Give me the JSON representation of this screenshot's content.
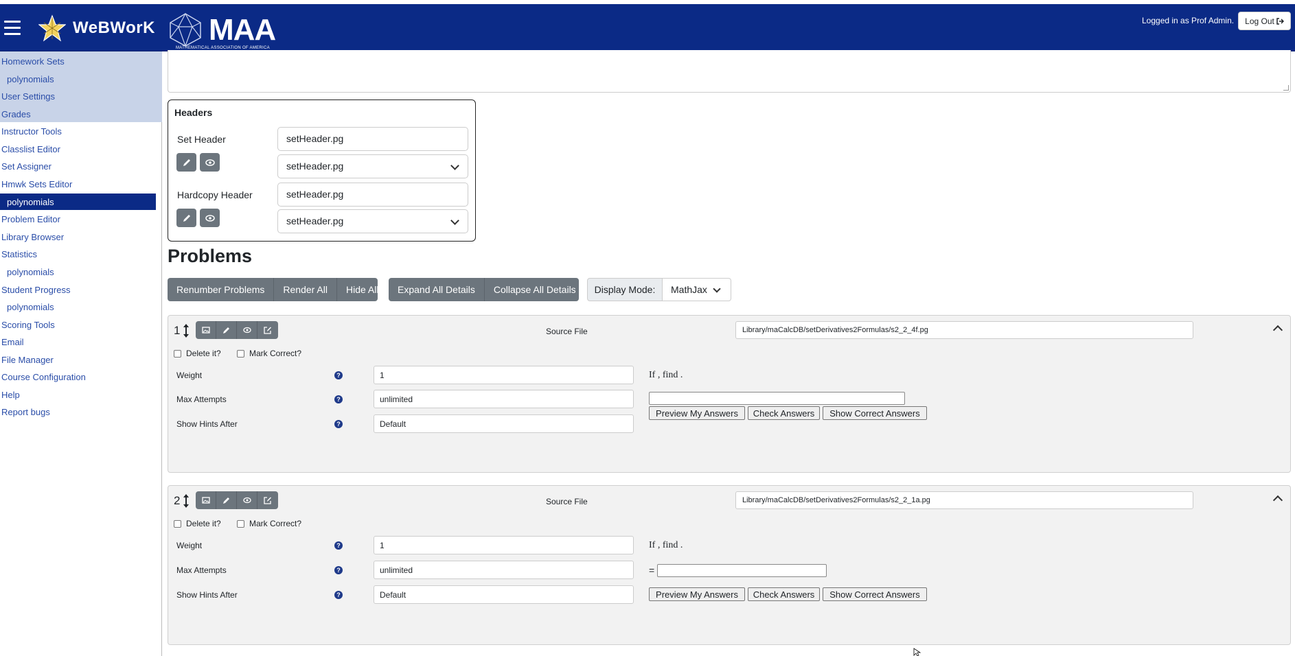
{
  "header": {
    "brand": "WeBWorK",
    "maa_name": "MAA",
    "maa_sub": "MATHEMATICAL ASSOCIATION OF AMERICA",
    "login_info": "Logged in as Prof Admin.",
    "logout_label": "Log Out"
  },
  "sidebar": {
    "items": [
      {
        "label": "Homework Sets"
      },
      {
        "label": "polynomials"
      },
      {
        "label": "User Settings"
      },
      {
        "label": "Grades"
      },
      {
        "label": "Instructor Tools"
      },
      {
        "label": "Classlist Editor"
      },
      {
        "label": "Set Assigner"
      },
      {
        "label": "Hmwk Sets Editor"
      },
      {
        "label": "polynomials"
      },
      {
        "label": "Problem Editor"
      },
      {
        "label": "Library Browser"
      },
      {
        "label": "Statistics"
      },
      {
        "label": "polynomials"
      },
      {
        "label": "Student Progress"
      },
      {
        "label": "polynomials"
      },
      {
        "label": "Scoring Tools"
      },
      {
        "label": "Email"
      },
      {
        "label": "File Manager"
      },
      {
        "label": "Course Configuration"
      },
      {
        "label": "Help"
      },
      {
        "label": "Report bugs"
      }
    ]
  },
  "headers_box": {
    "title": "Headers",
    "set_header_label": "Set Header",
    "set_header_value": "setHeader.pg",
    "set_header_select": "setHeader.pg",
    "hardcopy_header_label": "Hardcopy Header",
    "hardcopy_header_value": "setHeader.pg",
    "hardcopy_header_select": "setHeader.pg"
  },
  "problems": {
    "title": "Problems",
    "buttons_group1": [
      "Renumber Problems",
      "Render All",
      "Hide All"
    ],
    "buttons_group2": [
      "Expand All Details",
      "Collapse All Details"
    ],
    "display_mode_label": "Display Mode:",
    "display_mode_value": "MathJax",
    "list": [
      {
        "number": "1",
        "source_label": "Source File",
        "source_file": "Library/maCalcDB/setDerivatives2Formulas/s2_2_4f.pg",
        "delete_label": "Delete it?",
        "mark_label": "Mark Correct?",
        "weight_label": "Weight",
        "weight": "1",
        "max_attempts_label": "Max Attempts",
        "max_attempts": "unlimited",
        "hints_label": "Show Hints After",
        "hints": "Default",
        "question": "If , find .",
        "preview_label": "Preview My Answers",
        "check_label": "Check Answers",
        "show_label": "Show Correct Answers"
      },
      {
        "number": "2",
        "source_label": "Source File",
        "source_file": "Library/maCalcDB/setDerivatives2Formulas/s2_2_1a.pg",
        "delete_label": "Delete it?",
        "mark_label": "Mark Correct?",
        "weight_label": "Weight",
        "weight": "1",
        "max_attempts_label": "Max Attempts",
        "max_attempts": "unlimited",
        "hints_label": "Show Hints After",
        "hints": "Default",
        "question": "If , find .",
        "equals": "=",
        "preview_label": "Preview My Answers",
        "check_label": "Check Answers",
        "show_label": "Show Correct Answers"
      }
    ]
  },
  "colors": {
    "header_bg": "#0b2a86",
    "active_nav": "#0b2a86",
    "sidebar_shade": "#c8d3e8",
    "link": "#2a4da8",
    "btn_gray": "#6c757d"
  }
}
